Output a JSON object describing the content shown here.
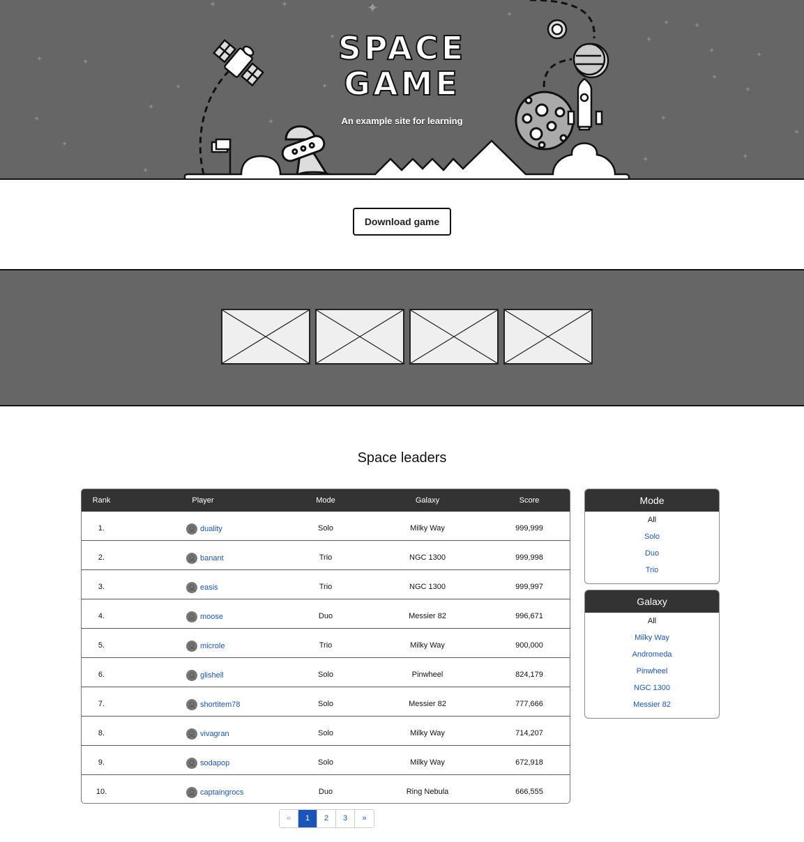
{
  "hero": {
    "title_line1": "SPACE",
    "title_line2": "GAME",
    "subtitle": "An example site for learning"
  },
  "download": {
    "label": "Download game"
  },
  "gallery": {
    "count": 4
  },
  "leaderboard": {
    "title": "Space leaders",
    "columns": [
      "Rank",
      "Player",
      "Mode",
      "Galaxy",
      "Score"
    ],
    "rows": [
      {
        "rank": "1.",
        "player": "duality",
        "mode": "Solo",
        "galaxy": "Milky Way",
        "score": "999,999"
      },
      {
        "rank": "2.",
        "player": "banant",
        "mode": "Trio",
        "galaxy": "NGC 1300",
        "score": "999,998"
      },
      {
        "rank": "3.",
        "player": "easis",
        "mode": "Trio",
        "galaxy": "NGC 1300",
        "score": "999,997"
      },
      {
        "rank": "4.",
        "player": "moose",
        "mode": "Duo",
        "galaxy": "Messier 82",
        "score": "996,671"
      },
      {
        "rank": "5.",
        "player": "microle",
        "mode": "Trio",
        "galaxy": "Milky Way",
        "score": "900,000"
      },
      {
        "rank": "6.",
        "player": "glishell",
        "mode": "Solo",
        "galaxy": "Pinwheel",
        "score": "824,179"
      },
      {
        "rank": "7.",
        "player": "shortitem78",
        "mode": "Solo",
        "galaxy": "Messier 82",
        "score": "777,666"
      },
      {
        "rank": "8.",
        "player": "vivagran",
        "mode": "Solo",
        "galaxy": "Milky Way",
        "score": "714,207"
      },
      {
        "rank": "9.",
        "player": "sodapop",
        "mode": "Solo",
        "galaxy": "Milky Way",
        "score": "672,918"
      },
      {
        "rank": "10.",
        "player": "captaingrocs",
        "mode": "Duo",
        "galaxy": "Ring Nebula",
        "score": "666,555"
      }
    ]
  },
  "filters": {
    "mode": {
      "title": "Mode",
      "items": [
        "All",
        "Solo",
        "Duo",
        "Trio"
      ],
      "selected": "All"
    },
    "galaxy": {
      "title": "Galaxy",
      "items": [
        "All",
        "Milky Way",
        "Andromeda",
        "Pinwheel",
        "NGC 1300",
        "Messier 82"
      ],
      "selected": "All"
    }
  },
  "pagination": {
    "prev": "«",
    "pages": [
      "1",
      "2",
      "3"
    ],
    "next": "»",
    "current": "1"
  },
  "colors": {
    "hero_bg": "#666666",
    "link": "#1a56b8",
    "header_bg": "#333333"
  }
}
